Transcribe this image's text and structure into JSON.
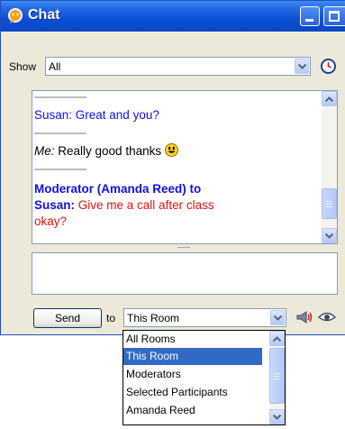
{
  "window": {
    "title": "Chat"
  },
  "filter": {
    "label": "Show",
    "value": "All"
  },
  "messages": [
    {
      "sender": "Susan: ",
      "text": "Great and you?"
    },
    {
      "sender": "Me:",
      "text": " Really good thanks"
    },
    {
      "header_line1": "Moderator (Amanda Reed) to",
      "header_line2": "Susan:",
      "text_line1": "Give me a call after class",
      "text_line2": "okay?"
    }
  ],
  "composer": {
    "input_value": "",
    "send_label": "Send",
    "to_label": "to",
    "recipient": "This Room"
  },
  "recipient_options": [
    "All Rooms",
    "This Room",
    "Moderators",
    "Selected Participants",
    "Amanda Reed"
  ],
  "recipient_selected_index": 1,
  "icons": {
    "title": "chat-bubble-icon",
    "history": "clock-icon",
    "emoticon": "smiley-icon",
    "broadcast": "megaphone-icon",
    "view": "eye-icon"
  },
  "colors": {
    "titlebar": "#0c4fd5",
    "sender": "#1010e8",
    "highlight_text": "#e81010",
    "selection": "#316ac5"
  }
}
